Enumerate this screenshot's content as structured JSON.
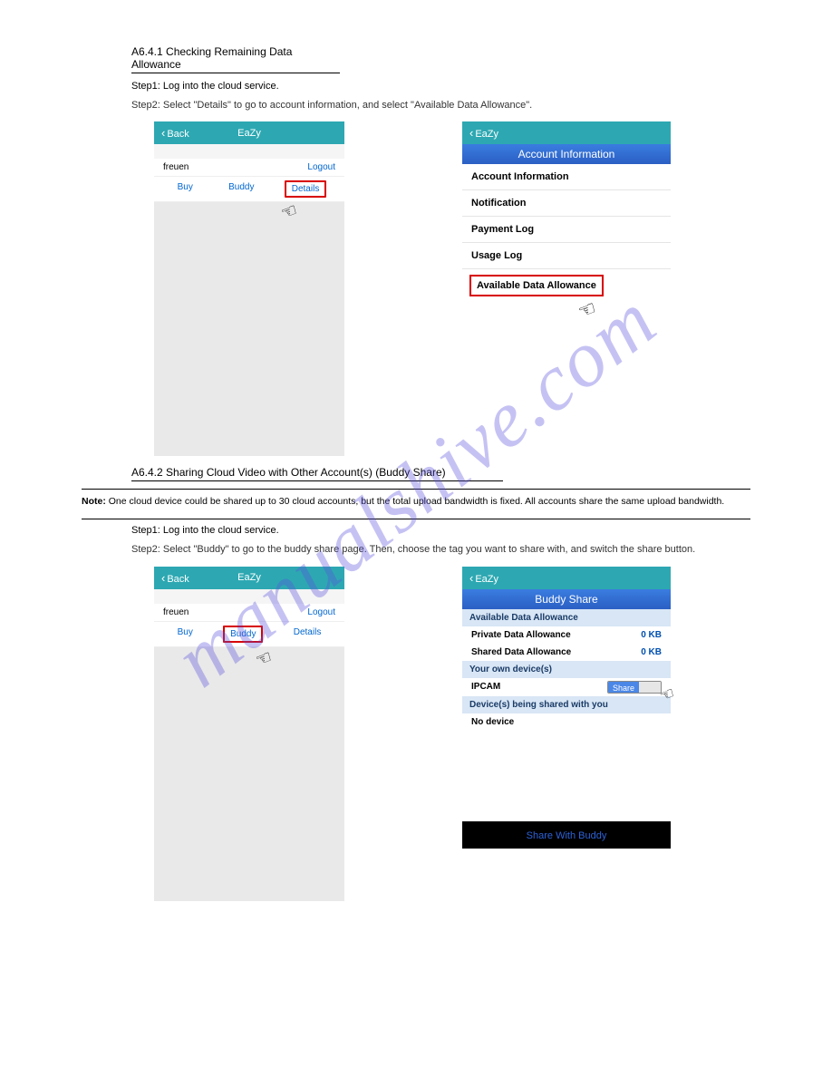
{
  "watermark": "manualshive.com",
  "sectionA": {
    "title": "A6.4.1 Checking Remaining Data Allowance",
    "lead": "Step1: Log into the cloud service.",
    "desc": "Step2: Select \"Details\" to go to account information, and select \"Available Data Allowance\".",
    "leftPhone": {
      "back": "Back",
      "title": "EaZy",
      "user": "freuen",
      "logout": "Logout",
      "tabs": {
        "buy": "Buy",
        "buddy": "Buddy",
        "details": "Details"
      }
    },
    "rightPhone": {
      "back": "EaZy",
      "band": "Account Information",
      "items": {
        "i1": "Account Information",
        "i2": "Notification",
        "i3": "Payment Log",
        "i4": "Usage Log",
        "i5": "Available Data Allowance"
      }
    }
  },
  "sectionB": {
    "title": "A6.4.2 Sharing Cloud Video with Other Account(s) (Buddy Share)",
    "noteLabel": "Note:",
    "note1": "One cloud device could be shared up to 30 cloud accounts, but the total upload bandwidth is fixed. All accounts share the same upload bandwidth.",
    "lead": "Step1: Log into the cloud service.",
    "desc": "Step2: Select \"Buddy\" to go to the buddy share page. Then, choose the tag you want to share with, and switch the share button.",
    "leftPhone": {
      "back": "Back",
      "title": "EaZy",
      "user": "freuen",
      "logout": "Logout",
      "tabs": {
        "buy": "Buy",
        "buddy": "Buddy",
        "details": "Details"
      }
    },
    "rightPhone": {
      "back": "EaZy",
      "band": "Buddy Share",
      "sub1": "Available Data Allowance",
      "row1": {
        "label": "Private Data Allowance",
        "val": "0 KB"
      },
      "row2": {
        "label": "Shared Data Allowance",
        "val": "0 KB"
      },
      "sub2": "Your own device(s)",
      "dev": {
        "name": "IPCAM",
        "share": "Share"
      },
      "sub3": "Device(s) being shared with you",
      "nodev": "No device",
      "bottom": "Share With Buddy"
    }
  }
}
